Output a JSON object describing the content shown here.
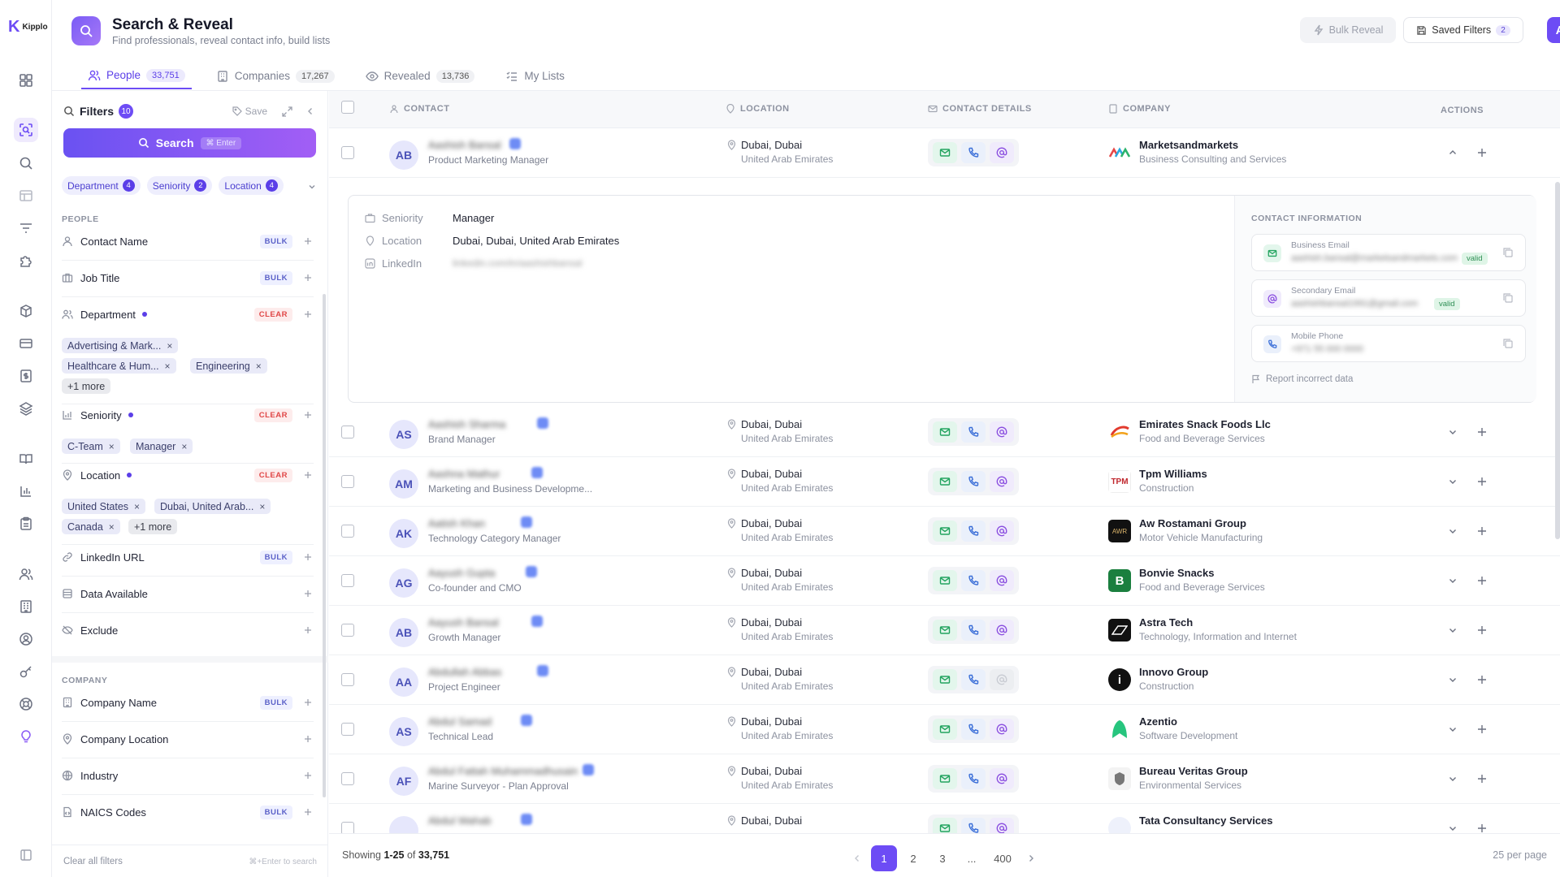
{
  "app": {
    "logo_text": "Kipplo"
  },
  "header": {
    "title": "Search & Reveal",
    "subtitle": "Find professionals, reveal contact info, build lists",
    "bulk_reveal": "Bulk Reveal",
    "saved_filters": "Saved Filters",
    "saved_filters_count": "2",
    "avatar": "A"
  },
  "tabs": [
    {
      "label": "People",
      "count": "33,751"
    },
    {
      "label": "Companies",
      "count": "17,267"
    },
    {
      "label": "Revealed",
      "count": "13,736"
    },
    {
      "label": "My Lists",
      "count": ""
    }
  ],
  "filters": {
    "title": "Filters",
    "count": "10",
    "save": "Save",
    "search_label": "Search",
    "search_kbd": "⌘ Enter",
    "chips": [
      {
        "label": "Department",
        "n": "4"
      },
      {
        "label": "Seniority",
        "n": "2"
      },
      {
        "label": "Location",
        "n": "4"
      }
    ],
    "people_section": "PEOPLE",
    "company_section": "COMPANY",
    "contact_name": "Contact Name",
    "job_title": "Job Title",
    "department": "Department",
    "department_pills": [
      "Advertising & Mark...",
      "Healthcare & Hum...",
      "Engineering",
      "+1 more"
    ],
    "seniority": "Seniority",
    "seniority_pills": [
      "C-Team",
      "Manager"
    ],
    "location": "Location",
    "location_pills": [
      "United States",
      "Dubai, United Arab...",
      "Canada",
      "+1 more"
    ],
    "linkedin_url": "LinkedIn URL",
    "data_available": "Data Available",
    "exclude": "Exclude",
    "company_name": "Company Name",
    "company_location": "Company Location",
    "industry": "Industry",
    "naics": "NAICS Codes",
    "bulk": "BULK",
    "clear": "CLEAR",
    "x": "×",
    "clear_all": "Clear all filters",
    "enter_hint": "⌘+Enter to search"
  },
  "table": {
    "headers": {
      "contact": "CONTACT",
      "location": "LOCATION",
      "details": "CONTACT DETAILS",
      "company": "COMPANY",
      "actions": "ACTIONS"
    },
    "rows": [
      {
        "initials": "AB",
        "name": "Aashish Bansal",
        "role": "Product Marketing Manager",
        "city": "Dubai, Dubai",
        "country": "United Arab Emirates",
        "company": "Marketsandmarkets",
        "industry": "Business Consulting and Services"
      },
      {
        "initials": "AS",
        "name": "Aashish Sharma",
        "role": "Brand Manager",
        "city": "Dubai, Dubai",
        "country": "United Arab Emirates",
        "company": "Emirates Snack Foods Llc",
        "industry": "Food and Beverage Services"
      },
      {
        "initials": "AM",
        "name": "Aashna Mathur",
        "role": "Marketing and Business Developme...",
        "city": "Dubai, Dubai",
        "country": "United Arab Emirates",
        "company": "Tpm Williams",
        "industry": "Construction"
      },
      {
        "initials": "AK",
        "name": "Aatish Khan",
        "role": "Technology Category Manager",
        "city": "Dubai, Dubai",
        "country": "United Arab Emirates",
        "company": "Aw Rostamani Group",
        "industry": "Motor Vehicle Manufacturing"
      },
      {
        "initials": "AG",
        "name": "Aayush Gupta",
        "role": "Co-founder and CMO",
        "city": "Dubai, Dubai",
        "country": "United Arab Emirates",
        "company": "Bonvie Snacks",
        "industry": "Food and Beverage Services"
      },
      {
        "initials": "AB",
        "name": "Aayush Bansal",
        "role": "Growth Manager",
        "city": "Dubai, Dubai",
        "country": "United Arab Emirates",
        "company": "Astra Tech",
        "industry": "Technology, Information and Internet"
      },
      {
        "initials": "AA",
        "name": "Abdullah Abbas",
        "role": "Project Engineer",
        "city": "Dubai, Dubai",
        "country": "United Arab Emirates",
        "company": "Innovo Group",
        "industry": "Construction"
      },
      {
        "initials": "AS",
        "name": "Abdul Samad",
        "role": "Technical Lead",
        "city": "Dubai, Dubai",
        "country": "United Arab Emirates",
        "company": "Azentio",
        "industry": "Software Development"
      },
      {
        "initials": "AF",
        "name": "Abdul Fattah Muhammadhusain",
        "role": "Marine Surveyor - Plan Approval",
        "city": "Dubai, Dubai",
        "country": "United Arab Emirates",
        "company": "Bureau Veritas Group",
        "industry": "Environmental Services"
      },
      {
        "initials": "",
        "name": "Abdul Wahab",
        "role": "",
        "city": "Dubai, Dubai",
        "country": "",
        "company": "Tata Consultancy Services",
        "industry": ""
      }
    ]
  },
  "detail": {
    "seniority_label": "Seniority",
    "seniority": "Manager",
    "location_label": "Location",
    "location": "Dubai, Dubai, United Arab Emirates",
    "linkedin_label": "LinkedIn",
    "linkedin": "linkedin.com/in/aashishbansal",
    "panel_title": "CONTACT INFORMATION",
    "business_email_label": "Business Email",
    "business_email": "aashish.bansal@marketsandmarkets.com",
    "secondary_email_label": "Secondary Email",
    "secondary_email": "aashishbansal1991@gmail.com",
    "mobile_label": "Mobile Phone",
    "mobile": "+971 55 000 0000",
    "valid": "valid",
    "report": "Report incorrect data"
  },
  "pagination": {
    "showing_prefix": "Showing",
    "range": "1-25",
    "of": "of",
    "total": "33,751",
    "pages": [
      "1",
      "2",
      "3",
      "...",
      "400"
    ],
    "per_page": "25 per page"
  }
}
